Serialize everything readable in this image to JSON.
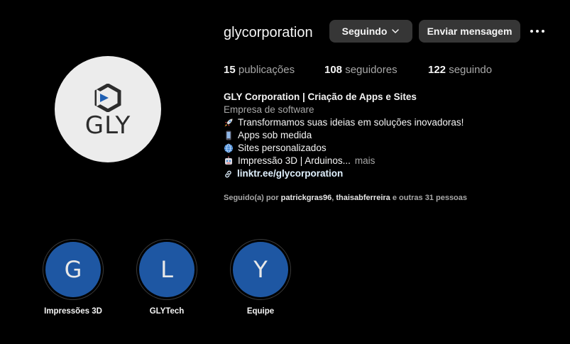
{
  "profile": {
    "username": "glycorporation",
    "avatar_text": "GLY",
    "avatar_icon": "gly-logo-mark",
    "buttons": {
      "following": "Seguindo",
      "message": "Enviar mensagem"
    },
    "stats": {
      "posts_count": "15",
      "posts_label": "publicações",
      "followers_count": "108",
      "followers_label": "seguidores",
      "following_count": "122",
      "following_label": "seguindo"
    },
    "bio": {
      "name": "GLY Corporation | Criação de Apps e Sites",
      "category": "Empresa de software",
      "lines": [
        {
          "icon": "rocket-emoji",
          "text": "Transformamos suas ideias em soluções inovadoras!"
        },
        {
          "icon": "mobile-phone-emoji",
          "text": "Apps sob medida"
        },
        {
          "icon": "globe-emoji",
          "text": "Sites personalizados"
        },
        {
          "icon": "robot-emoji",
          "text": "Impressão 3D | Arduinos..."
        }
      ],
      "more_label": "mais",
      "link": "linktr.ee/glycorporation"
    },
    "followed_by": {
      "prefix": "Seguido(a) por",
      "user1": "patrickgras96",
      "separator": ",",
      "user2": "thaisabferreira",
      "suffix": "e outras 31 pessoas"
    }
  },
  "highlights": [
    {
      "letter": "G",
      "label": "Impressões 3D"
    },
    {
      "letter": "L",
      "label": "GLYTech"
    },
    {
      "letter": "Y",
      "label": "Equipe"
    }
  ],
  "colors": {
    "background": "#000000",
    "button_bg": "#363636",
    "highlight_bg": "#1e57a3",
    "secondary_text": "#a8a8a8",
    "link_text": "#e0f1ff",
    "logo_blue": "#1e5fb3"
  }
}
